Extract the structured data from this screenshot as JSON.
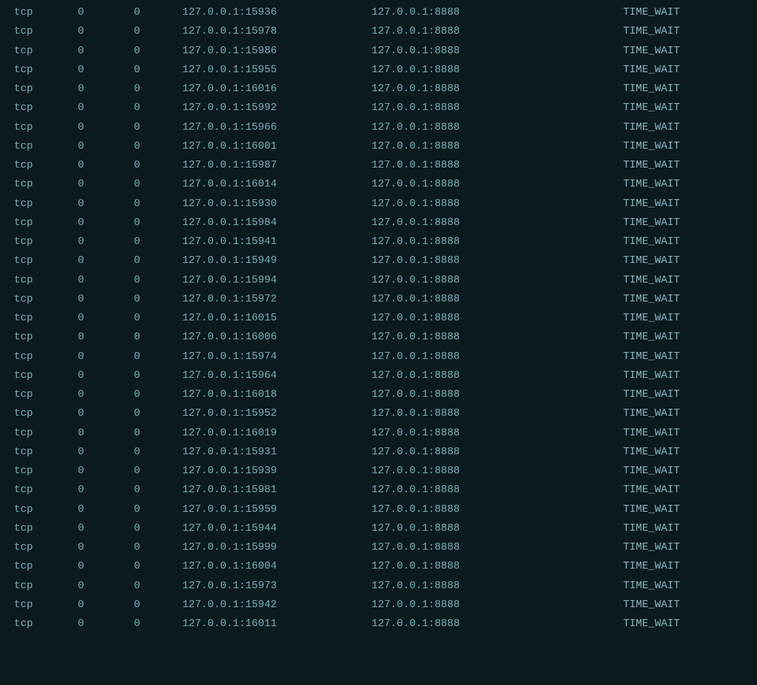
{
  "rows": [
    {
      "proto": "tcp",
      "recv_q": "0",
      "send_q": "0",
      "local": "127.0.0.1:15936",
      "remote": "127.0.0.1:8888",
      "state": "TIME_WAIT"
    },
    {
      "proto": "tcp",
      "recv_q": "0",
      "send_q": "0",
      "local": "127.0.0.1:15978",
      "remote": "127.0.0.1:8888",
      "state": "TIME_WAIT"
    },
    {
      "proto": "tcp",
      "recv_q": "0",
      "send_q": "0",
      "local": "127.0.0.1:15986",
      "remote": "127.0.0.1:8888",
      "state": "TIME_WAIT"
    },
    {
      "proto": "tcp",
      "recv_q": "0",
      "send_q": "0",
      "local": "127.0.0.1:15955",
      "remote": "127.0.0.1:8888",
      "state": "TIME_WAIT"
    },
    {
      "proto": "tcp",
      "recv_q": "0",
      "send_q": "0",
      "local": "127.0.0.1:16016",
      "remote": "127.0.0.1:8888",
      "state": "TIME_WAIT"
    },
    {
      "proto": "tcp",
      "recv_q": "0",
      "send_q": "0",
      "local": "127.0.0.1:15992",
      "remote": "127.0.0.1:8888",
      "state": "TIME_WAIT"
    },
    {
      "proto": "tcp",
      "recv_q": "0",
      "send_q": "0",
      "local": "127.0.0.1:15966",
      "remote": "127.0.0.1:8888",
      "state": "TIME_WAIT"
    },
    {
      "proto": "tcp",
      "recv_q": "0",
      "send_q": "0",
      "local": "127.0.0.1:16001",
      "remote": "127.0.0.1:8888",
      "state": "TIME_WAIT"
    },
    {
      "proto": "tcp",
      "recv_q": "0",
      "send_q": "0",
      "local": "127.0.0.1:15987",
      "remote": "127.0.0.1:8888",
      "state": "TIME_WAIT"
    },
    {
      "proto": "tcp",
      "recv_q": "0",
      "send_q": "0",
      "local": "127.0.0.1:16014",
      "remote": "127.0.0.1:8888",
      "state": "TIME_WAIT"
    },
    {
      "proto": "tcp",
      "recv_q": "0",
      "send_q": "0",
      "local": "127.0.0.1:15930",
      "remote": "127.0.0.1:8888",
      "state": "TIME_WAIT"
    },
    {
      "proto": "tcp",
      "recv_q": "0",
      "send_q": "0",
      "local": "127.0.0.1:15984",
      "remote": "127.0.0.1:8888",
      "state": "TIME_WAIT"
    },
    {
      "proto": "tcp",
      "recv_q": "0",
      "send_q": "0",
      "local": "127.0.0.1:15941",
      "remote": "127.0.0.1:8888",
      "state": "TIME_WAIT"
    },
    {
      "proto": "tcp",
      "recv_q": "0",
      "send_q": "0",
      "local": "127.0.0.1:15949",
      "remote": "127.0.0.1:8888",
      "state": "TIME_WAIT"
    },
    {
      "proto": "tcp",
      "recv_q": "0",
      "send_q": "0",
      "local": "127.0.0.1:15994",
      "remote": "127.0.0.1:8888",
      "state": "TIME_WAIT"
    },
    {
      "proto": "tcp",
      "recv_q": "0",
      "send_q": "0",
      "local": "127.0.0.1:15972",
      "remote": "127.0.0.1:8888",
      "state": "TIME_WAIT"
    },
    {
      "proto": "tcp",
      "recv_q": "0",
      "send_q": "0",
      "local": "127.0.0.1:16015",
      "remote": "127.0.0.1:8888",
      "state": "TIME_WAIT"
    },
    {
      "proto": "tcp",
      "recv_q": "0",
      "send_q": "0",
      "local": "127.0.0.1:16006",
      "remote": "127.0.0.1:8888",
      "state": "TIME_WAIT"
    },
    {
      "proto": "tcp",
      "recv_q": "0",
      "send_q": "0",
      "local": "127.0.0.1:15974",
      "remote": "127.0.0.1:8888",
      "state": "TIME_WAIT"
    },
    {
      "proto": "tcp",
      "recv_q": "0",
      "send_q": "0",
      "local": "127.0.0.1:15964",
      "remote": "127.0.0.1:8888",
      "state": "TIME_WAIT"
    },
    {
      "proto": "tcp",
      "recv_q": "0",
      "send_q": "0",
      "local": "127.0.0.1:16018",
      "remote": "127.0.0.1:8888",
      "state": "TIME_WAIT"
    },
    {
      "proto": "tcp",
      "recv_q": "0",
      "send_q": "0",
      "local": "127.0.0.1:15952",
      "remote": "127.0.0.1:8888",
      "state": "TIME_WAIT"
    },
    {
      "proto": "tcp",
      "recv_q": "0",
      "send_q": "0",
      "local": "127.0.0.1:16019",
      "remote": "127.0.0.1:8888",
      "state": "TIME_WAIT"
    },
    {
      "proto": "tcp",
      "recv_q": "0",
      "send_q": "0",
      "local": "127.0.0.1:15931",
      "remote": "127.0.0.1:8888",
      "state": "TIME_WAIT"
    },
    {
      "proto": "tcp",
      "recv_q": "0",
      "send_q": "0",
      "local": "127.0.0.1:15939",
      "remote": "127.0.0.1:8888",
      "state": "TIME_WAIT"
    },
    {
      "proto": "tcp",
      "recv_q": "0",
      "send_q": "0",
      "local": "127.0.0.1:15981",
      "remote": "127.0.0.1:8888",
      "state": "TIME_WAIT"
    },
    {
      "proto": "tcp",
      "recv_q": "0",
      "send_q": "0",
      "local": "127.0.0.1:15959",
      "remote": "127.0.0.1:8888",
      "state": "TIME_WAIT"
    },
    {
      "proto": "tcp",
      "recv_q": "0",
      "send_q": "0",
      "local": "127.0.0.1:15944",
      "remote": "127.0.0.1:8888",
      "state": "TIME_WAIT"
    },
    {
      "proto": "tcp",
      "recv_q": "0",
      "send_q": "0",
      "local": "127.0.0.1:15999",
      "remote": "127.0.0.1:8888",
      "state": "TIME_WAIT"
    },
    {
      "proto": "tcp",
      "recv_q": "0",
      "send_q": "0",
      "local": "127.0.0.1:16004",
      "remote": "127.0.0.1:8888",
      "state": "TIME_WAIT"
    },
    {
      "proto": "tcp",
      "recv_q": "0",
      "send_q": "0",
      "local": "127.0.0.1:15973",
      "remote": "127.0.0.1:8888",
      "state": "TIME_WAIT"
    },
    {
      "proto": "tcp",
      "recv_q": "0",
      "send_q": "0",
      "local": "127.0.0.1:15942",
      "remote": "127.0.0.1:8888",
      "state": "TIME_WAIT"
    },
    {
      "proto": "tcp",
      "recv_q": "0",
      "send_q": "0",
      "local": "127.0.0.1:16011",
      "remote": "127.0.0.1:8888",
      "state": "TIME_WAIT"
    }
  ]
}
